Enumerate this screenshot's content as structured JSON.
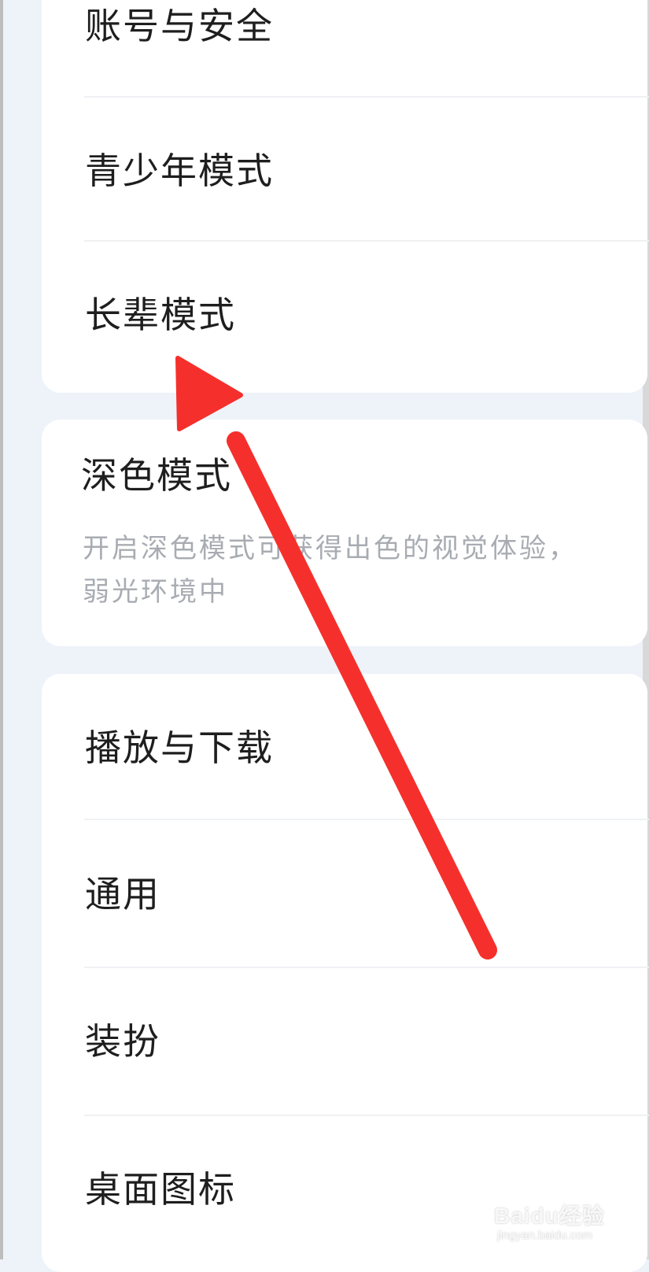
{
  "settings": {
    "group1": [
      {
        "label": "账号与安全"
      },
      {
        "label": "青少年模式"
      },
      {
        "label": "长辈模式"
      }
    ],
    "dark_mode": {
      "title": "深色模式",
      "description_line1": "开启深色模式可获得出色的视觉体验，",
      "description_line2": "弱光环境中"
    },
    "group3": [
      {
        "label": "播放与下载"
      },
      {
        "label": "通用"
      },
      {
        "label": "装扮"
      },
      {
        "label": "桌面图标"
      }
    ]
  },
  "annotation": {
    "arrow_color": "#f5302c"
  },
  "watermark": {
    "brand": "Baidu经验",
    "url": "jingyan.baidu.com"
  },
  "colors": {
    "background": "#eef2f9",
    "card": "#ffffff",
    "text_primary": "#1e1e1e",
    "text_secondary": "#a8acb2",
    "divider": "#f0f1f4"
  }
}
